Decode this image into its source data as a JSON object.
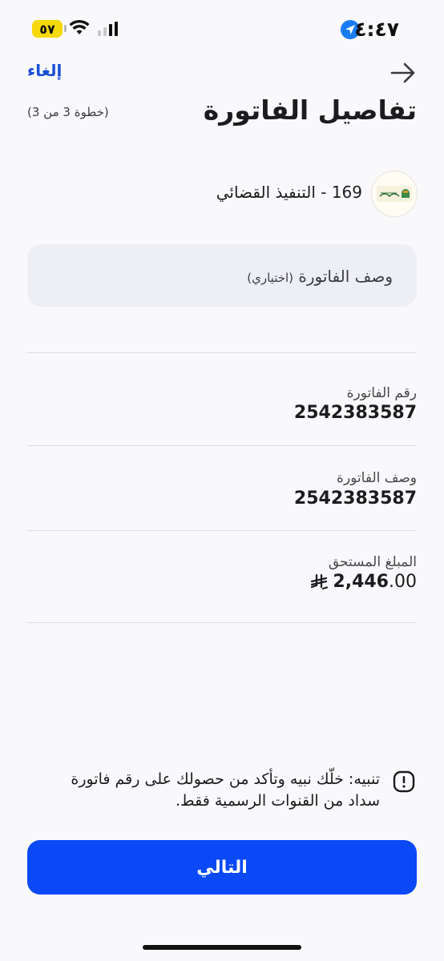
{
  "status_bar": {
    "time": "٤:٤٧",
    "battery": "٥٧"
  },
  "header": {
    "cancel_label": "إلغاء",
    "title": "تفاصيل الفاتورة",
    "step": "(خطوة 3 من 3)"
  },
  "biller": {
    "name": "169 - التنفيذ القضائي"
  },
  "description_input": {
    "placeholder_main": "وصف الفاتورة",
    "placeholder_optional": "(اختياري)"
  },
  "fields": {
    "invoice_number_label": "رقم الفاتورة",
    "invoice_number_value": "2542383587",
    "invoice_desc_label": "وصف الفاتورة",
    "invoice_desc_value": "2542383587",
    "amount_label": "المبلغ المستحق",
    "amount_integer": "2,446",
    "amount_decimal": ".00"
  },
  "warning": {
    "text": "تنبيه: خلّك نبيه وتأكد من حصولك على رقم فاتورة سداد من القنوات الرسمية فقط."
  },
  "next_button": {
    "label": "التالي"
  },
  "colors": {
    "accent": "#0a49f5",
    "link": "#1a4fd6",
    "background": "#f9f9fc",
    "input_bg": "#eeeff5"
  }
}
